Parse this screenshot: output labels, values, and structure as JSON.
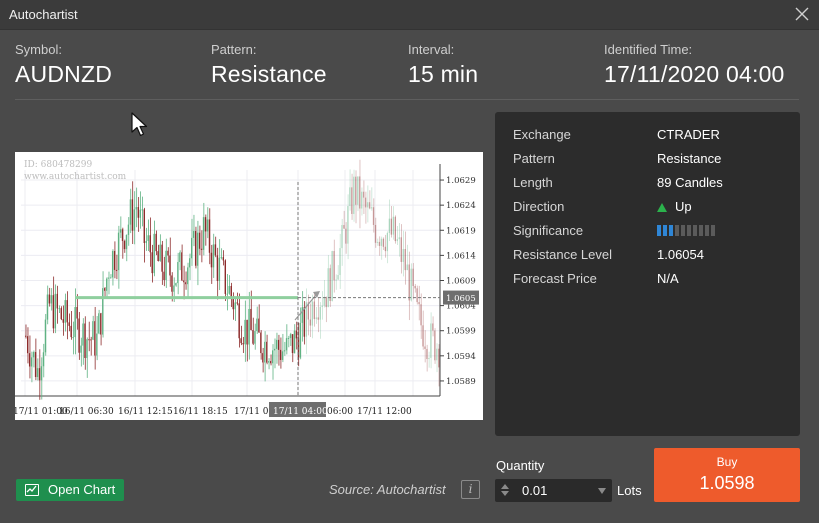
{
  "window": {
    "title": "Autochartist"
  },
  "header": {
    "symbol_label": "Symbol:",
    "symbol": "AUDNZD",
    "pattern_label": "Pattern:",
    "pattern": "Resistance",
    "interval_label": "Interval:",
    "interval": "15 min",
    "time_label": "Identified Time:",
    "time": "17/11/2020 04:00"
  },
  "chart_data": {
    "type": "candlestick",
    "watermark_id": "ID: 680478299",
    "watermark_url": "www.autochartist.com",
    "y_ticks": [
      "1.0629",
      "1.0624",
      "1.0619",
      "1.0614",
      "1.0609",
      "1.0604",
      "1.0599",
      "1.0594",
      "1.0589"
    ],
    "y_tick_values": [
      1.0629,
      1.0624,
      1.0619,
      1.0614,
      1.0609,
      1.0604,
      1.0599,
      1.0594,
      1.0589
    ],
    "ylim": [
      1.0586,
      1.0631
    ],
    "x_ticks": [
      "17/11 01:00",
      "16/11 06:30",
      "16/11 12:15",
      "16/11 18:15",
      "17/11 00:",
      "17/11 04:00",
      "06:00",
      "17/11 12:00"
    ],
    "current_price_label": "1.0605",
    "current_price": 1.06054,
    "resistance_level": 1.06054,
    "identified_time_label": "17/11 04:00",
    "colors": {
      "up": "#5fb283",
      "down": "#8d2b2b",
      "resistance": "#8fcf9e",
      "price_tag": "#6e6e6e"
    }
  },
  "details": {
    "rows": [
      {
        "key": "Exchange",
        "value": "CTRADER"
      },
      {
        "key": "Pattern",
        "value": "Resistance"
      },
      {
        "key": "Length",
        "value": "89 Candles"
      },
      {
        "key": "Direction",
        "value": "Up"
      },
      {
        "key": "Significance",
        "value": ""
      },
      {
        "key": "Resistance Level",
        "value": "1.06054"
      },
      {
        "key": "Forecast Price",
        "value": "N/A"
      }
    ],
    "direction_icon": "up-triangle-icon",
    "significance_filled": 3,
    "significance_total": 10
  },
  "footer": {
    "open_chart": "Open Chart",
    "source": "Source: Autochartist",
    "info": "i",
    "quantity_label": "Quantity",
    "quantity_value": "0.01",
    "lots": "Lots",
    "buy_label": "Buy",
    "buy_price": "1.0598"
  },
  "colors": {
    "buy": "#ee5b2c",
    "open_chart": "#1f8f4e",
    "direction_up": "#2bb24c",
    "significance": "#2f86d6"
  }
}
